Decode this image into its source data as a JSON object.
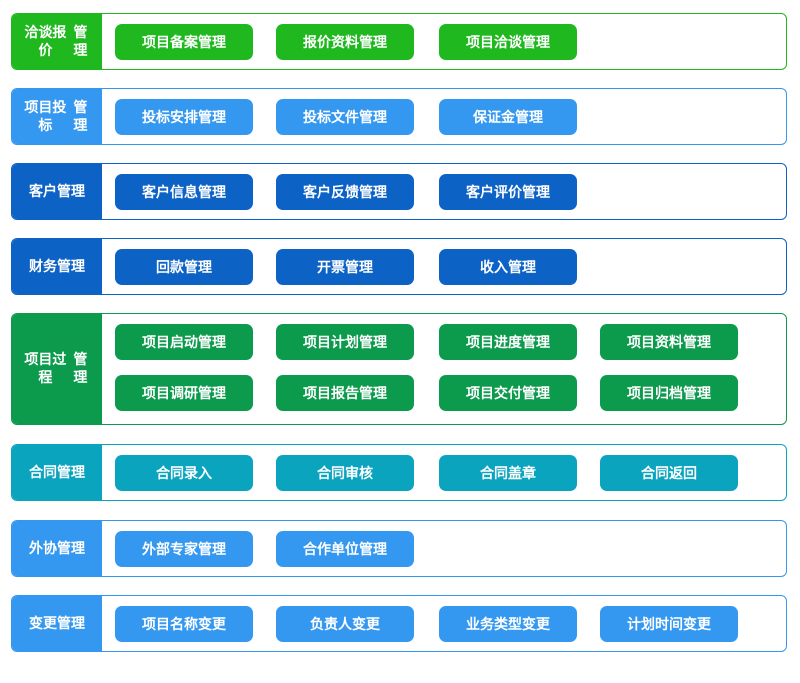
{
  "sections": [
    {
      "name": "negotiation-quote",
      "title": "洽谈报价管理",
      "color": "#1fb81f",
      "buttons": [
        "项目备案管理",
        "报价资料管理",
        "项目洽谈管理"
      ]
    },
    {
      "name": "project-bidding",
      "title": "项目投标管理",
      "color": "#3598f0",
      "buttons": [
        "投标安排管理",
        "投标文件管理",
        "保证金管理"
      ]
    },
    {
      "name": "customer-management",
      "title": "客户管理",
      "color": "#0d62c6",
      "buttons": [
        "客户信息管理",
        "客户反馈管理",
        "客户评价管理"
      ]
    },
    {
      "name": "finance-management",
      "title": "财务管理",
      "color": "#0d62c6",
      "buttons": [
        "回款管理",
        "开票管理",
        "收入管理"
      ]
    },
    {
      "name": "project-process",
      "title": "项目过程管理",
      "color": "#0c9a4c",
      "buttons": [
        "项目启动管理",
        "项目计划管理",
        "项目进度管理",
        "项目资料管理",
        "项目调研管理",
        "项目报告管理",
        "项目交付管理",
        "项目归档管理"
      ]
    },
    {
      "name": "contract-management",
      "title": "合同管理",
      "color": "#0aa4bf",
      "buttons": [
        "合同录入",
        "合同审核",
        "合同盖章",
        "合同返回"
      ]
    },
    {
      "name": "outsourcing-management",
      "title": "外协管理",
      "color": "#3598f0",
      "buttons": [
        "外部专家管理",
        "合作单位管理"
      ]
    },
    {
      "name": "change-management",
      "title": "变更管理",
      "color": "#3598f0",
      "buttons": [
        "项目名称变更",
        "负责人变更",
        "业务类型变更",
        "计划时间变更"
      ]
    }
  ]
}
